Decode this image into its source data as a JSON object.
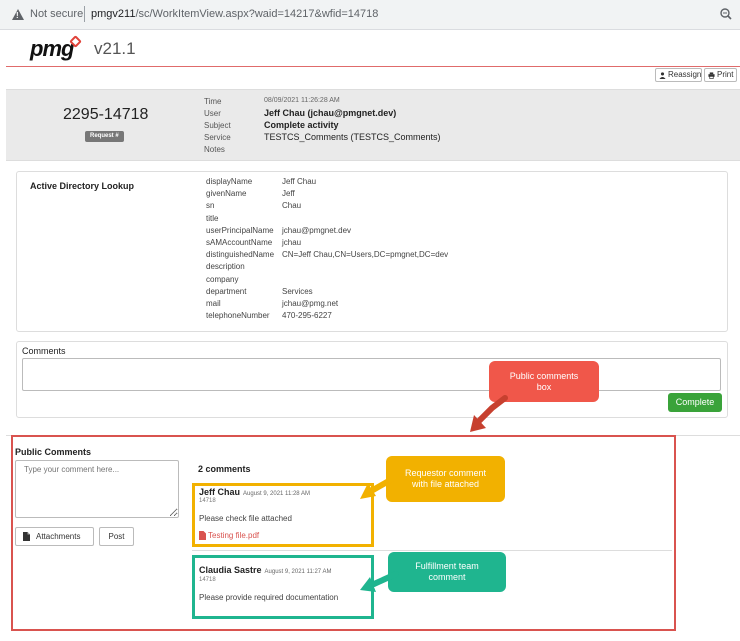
{
  "browser": {
    "security_label": "Not secure",
    "url_host": "pmgv211",
    "url_path": "/sc/WorkItemView.aspx?waid=14217&wfid=14718"
  },
  "header": {
    "logo_text": "pmg",
    "version": "v21.1"
  },
  "toolbar": {
    "reassign_label": "Reassign",
    "print_label": "Print"
  },
  "request": {
    "number": "2295-14718",
    "badge": "Request #",
    "fields": [
      {
        "label": "Time",
        "value": "08/09/2021 11:26:28 AM"
      },
      {
        "label": "User",
        "value": "Jeff Chau (jchau@pmgnet.dev)"
      },
      {
        "label": "Subject",
        "value": "Complete activity"
      },
      {
        "label": "Service",
        "value": "TESTCS_Comments (TESTCS_Comments)"
      },
      {
        "label": "Notes",
        "value": ""
      }
    ]
  },
  "ad_lookup": {
    "title": "Active Directory Lookup",
    "rows": [
      {
        "key": "displayName",
        "value": "Jeff Chau"
      },
      {
        "key": "givenName",
        "value": "Jeff"
      },
      {
        "key": "sn",
        "value": "Chau"
      },
      {
        "key": "title",
        "value": ""
      },
      {
        "key": "userPrincipalName",
        "value": "jchau@pmgnet.dev"
      },
      {
        "key": "sAMAccountName",
        "value": "jchau"
      },
      {
        "key": "distinguishedName",
        "value": "CN=Jeff Chau,CN=Users,DC=pmgnet,DC=dev"
      },
      {
        "key": "description",
        "value": ""
      },
      {
        "key": "company",
        "value": ""
      },
      {
        "key": "department",
        "value": "Services"
      },
      {
        "key": "mail",
        "value": "jchau@pmg.net"
      },
      {
        "key": "telephoneNumber",
        "value": "470-295-6227"
      }
    ]
  },
  "comments_box": {
    "title": "Comments",
    "value": "",
    "complete_label": "Complete"
  },
  "public_comments": {
    "title": "Public Comments",
    "placeholder": "Type your comment here...",
    "attachments_label": "Attachments",
    "post_label": "Post",
    "count_label": "2 comments",
    "items": [
      {
        "author": "Jeff Chau",
        "date": "August 9, 2021 11:28 AM",
        "id": "14718",
        "text": "Please check file attached",
        "attachment": "Testing file.pdf"
      },
      {
        "author": "Claudia Sastre",
        "date": "August 9, 2021 11:27 AM",
        "id": "14718",
        "text": "Please provide required documentation"
      }
    ]
  },
  "callouts": {
    "public_box": "Public comments box",
    "requestor": "Requestor comment with file attached",
    "fulfillment": "Fulfillment team comment"
  },
  "colors": {
    "red_frame": "#d9534f",
    "callout_red": "#f0574a",
    "callout_yellow": "#f2b100",
    "callout_teal": "#1fb58f",
    "complete_green": "#3aa33a"
  },
  "icons": [
    "warning-icon",
    "zoom-icon",
    "user-icon",
    "print-icon",
    "file-icon",
    "pdf-icon"
  ]
}
